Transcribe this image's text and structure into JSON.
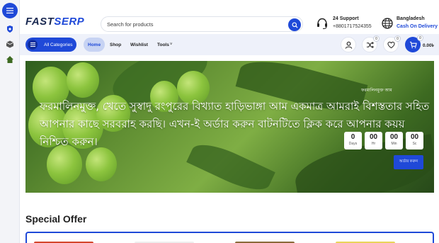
{
  "brand": {
    "logo_part1": "FAST",
    "logo_part2": "SERP"
  },
  "search": {
    "placeholder": "Search for products"
  },
  "support": {
    "title": "24 Support",
    "phone": "+8801717524355"
  },
  "country": {
    "name": "Bangladesh",
    "payment": "Cash On Delivery"
  },
  "nav": {
    "all_categories": "All Categories",
    "links": [
      "Home",
      "Shop",
      "Wishlist",
      "Tools"
    ],
    "tools_arrow": "˅"
  },
  "actions": {
    "compare_count": "0",
    "wishlist_count": "0",
    "cart_count": "0",
    "cart_total": "0.00৳"
  },
  "hero": {
    "overlay_small": "ফরমালিনমুক্ত আম",
    "headline": "ফরমালিনমুক্ত, খেতে সুস্বাদু রংপুরের বিখ্যাত হাড়িভাঙ্গা আম একমাত্র আমরাই বিশস্ততার সহিত আপনার কাছে সরবরাহ করছি। এখন-ই অর্ডার করুন বাটনটিতে ক্লিক করে আপনার কয়য় নিশ্চিত করুন।",
    "countdown": [
      {
        "value": "0",
        "unit": "Days"
      },
      {
        "value": "00",
        "unit": "Hr"
      },
      {
        "value": "00",
        "unit": "Min"
      },
      {
        "value": "00",
        "unit": "Sc"
      }
    ],
    "cta": "অর্ডার করুন"
  },
  "special": {
    "title": "Special Offer"
  },
  "colors": {
    "accent": "#1f49d8",
    "dark_text": "#222222",
    "nav_bg": "#eef1fa"
  },
  "icons": [
    "menu-icon",
    "shield-icon",
    "box-icon",
    "house-icon",
    "search-icon",
    "headset-icon",
    "globe-icon",
    "user-icon",
    "shuffle-icon",
    "heart-icon",
    "cart-icon"
  ]
}
